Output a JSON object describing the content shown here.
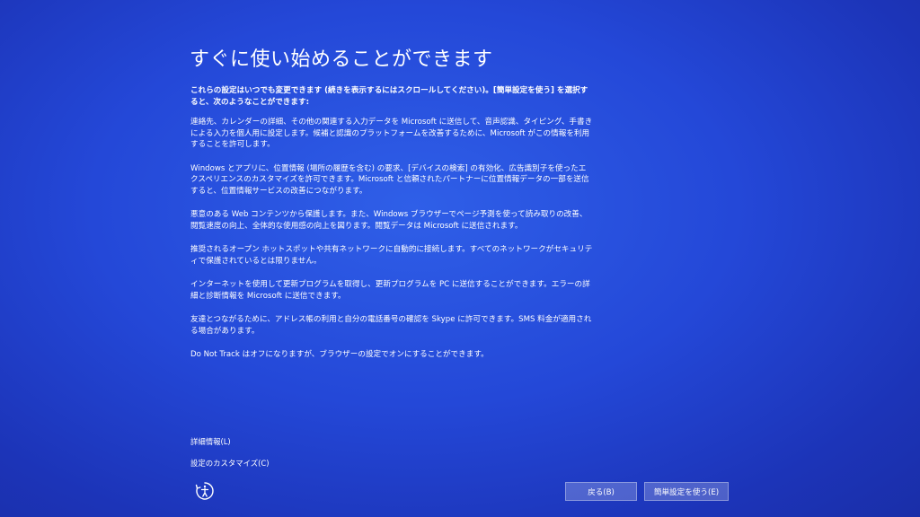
{
  "page": {
    "title": "すぐに使い始めることができます",
    "intro": "これらの設定はいつでも変更できます (続きを表示するにはスクロールしてください)。[簡単設定を使う] を選択すると、次のようなことができます:",
    "paragraphs": [
      "連絡先、カレンダーの詳細、その他の関連する入力データを Microsoft に送信して、音声認識、タイピング、手書きによる入力を個人用に設定します。候補と認識のプラットフォームを改善するために、Microsoft がこの情報を利用することを許可します。",
      "Windows とアプリに、位置情報 (場所の履歴を含む) の要求、[デバイスの検索] の有効化、広告識別子を使ったエクスペリエンスのカスタマイズを許可できます。Microsoft と信頼されたパートナーに位置情報データの一部を送信すると、位置情報サービスの改善につながります。",
      "悪意のある Web コンテンツから保護します。また、Windows ブラウザーでページ予測を使って読み取りの改善、閲覧速度の向上、全体的な使用感の向上を図ります。閲覧データは Microsoft に送信されます。",
      "推奨されるオープン ホットスポットや共有ネットワークに自動的に接続します。すべてのネットワークがセキュリティで保護されているとは限りません。",
      "インターネットを使用して更新プログラムを取得し、更新プログラムを PC に送信することができます。エラーの詳細と診断情報を Microsoft に送信できます。",
      "友達とつながるために、アドレス帳の利用と自分の電話番号の確認を Skype に許可できます。SMS 料金が適用される場合があります。",
      "Do Not Track はオフになりますが、ブラウザーの設定でオンにすることができます。"
    ]
  },
  "links": {
    "learn_more": "詳細情報(L)",
    "customize": "設定のカスタマイズ(C)"
  },
  "buttons": {
    "back": "戻る(B)",
    "express": "簡単設定を使う(E)"
  },
  "icons": {
    "accessibility": "ease-of-access-icon"
  }
}
